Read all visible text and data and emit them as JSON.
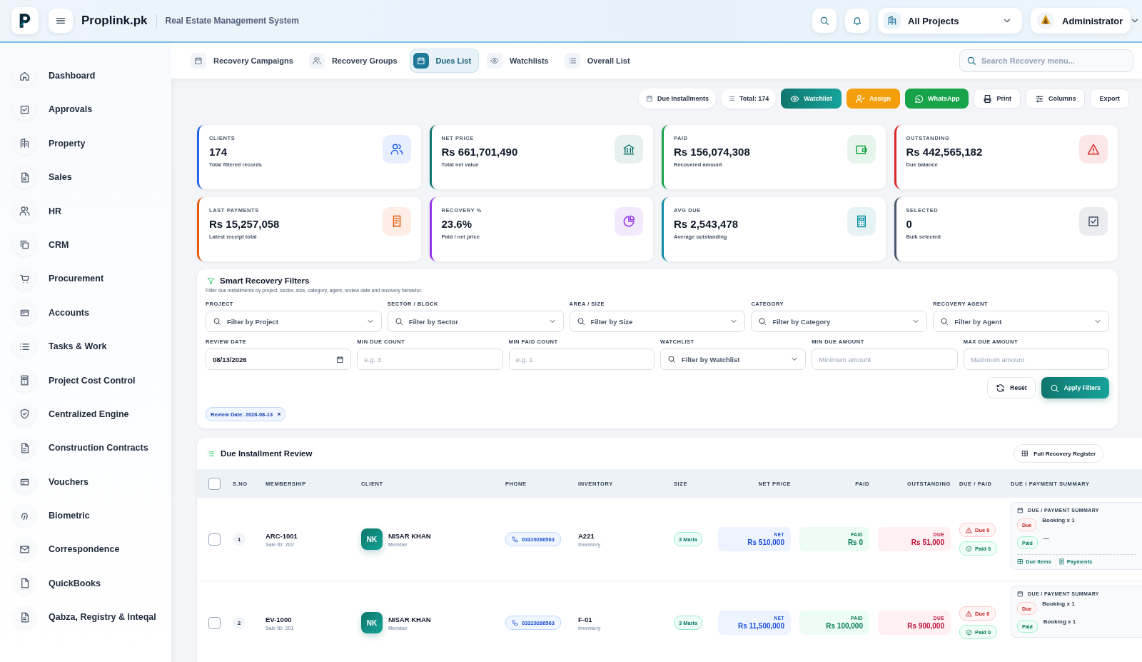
{
  "header": {
    "brand": "Proplink.pk",
    "subtitle": "Real Estate Management System",
    "project_select": "All Projects",
    "user": "Administrator"
  },
  "sidebar": {
    "items": [
      {
        "label": "Dashboard",
        "selected": false
      },
      {
        "label": "Approvals",
        "selected": false
      },
      {
        "label": "Property",
        "selected": false
      },
      {
        "label": "Sales",
        "selected": false
      },
      {
        "label": "HR",
        "selected": false
      },
      {
        "label": "CRM",
        "selected": false
      },
      {
        "label": "Procurement",
        "selected": false
      },
      {
        "label": "Accounts",
        "selected": false
      },
      {
        "label": "Tasks & Work",
        "selected": false
      },
      {
        "label": "Project Cost Control",
        "selected": false
      },
      {
        "label": "Centralized Engine",
        "selected": false
      },
      {
        "label": "Construction Contracts",
        "selected": false
      },
      {
        "label": "Vouchers",
        "selected": false
      },
      {
        "label": "Biometric",
        "selected": false
      },
      {
        "label": "Correspondence",
        "selected": false
      },
      {
        "label": "QuickBooks",
        "selected": false
      },
      {
        "label": "Qabza, Registry & Inteqal",
        "selected": false
      }
    ]
  },
  "tabs": [
    {
      "label": "Recovery Campaigns",
      "selected": false
    },
    {
      "label": "Recovery Groups",
      "selected": false
    },
    {
      "label": "Dues List",
      "selected": true
    },
    {
      "label": "Watchlists",
      "selected": false
    },
    {
      "label": "Overall List",
      "selected": false
    }
  ],
  "search": {
    "placeholder": "Search Recovery menu..."
  },
  "toolbar": [
    {
      "label": "Due Installments",
      "kind": "chip"
    },
    {
      "label": "Total: 174",
      "kind": "chip"
    },
    {
      "label": "Watchlist",
      "kind": "teal"
    },
    {
      "label": "Assign",
      "kind": "orange"
    },
    {
      "label": "WhatsApp",
      "kind": "green"
    },
    {
      "label": "Print",
      "kind": "outline"
    },
    {
      "label": "Columns",
      "kind": "outline"
    },
    {
      "label": "Export",
      "kind": "outline"
    }
  ],
  "stats": [
    {
      "label": "CLIENTS",
      "value": "174",
      "caption": "Total filtered records",
      "color": "#2563eb"
    },
    {
      "label": "NET PRICE",
      "value": "Rs 661,701,490",
      "caption": "Total net value",
      "color": "#0f766e"
    },
    {
      "label": "PAID",
      "value": "Rs 156,074,308",
      "caption": "Recovered amount",
      "color": "#16a34a"
    },
    {
      "label": "OUTSTANDING",
      "value": "Rs 442,565,182",
      "caption": "Due balance",
      "color": "#dc2626"
    },
    {
      "label": "LAST PAYMENTS",
      "value": "Rs 15,257,058",
      "caption": "Latest receipt total",
      "color": "#ea580c"
    },
    {
      "label": "RECOVERY %",
      "value": "23.6%",
      "caption": "Paid / net price",
      "color": "#9333ea"
    },
    {
      "label": "AVG DUE",
      "value": "Rs 2,543,478",
      "caption": "Average outstanding",
      "color": "#0e8fa5"
    },
    {
      "label": "SELECTED",
      "value": "0",
      "caption": "Bulk selected",
      "color": "#475569"
    }
  ],
  "filters": {
    "title": "Smart Recovery Filters",
    "description": "Filter due installments by project, sector, size, category, agent, review date and recovery behavior.",
    "rows": [
      {
        "fields": [
          {
            "label": "PROJECT",
            "kind": "select",
            "placeholder": "Filter by Project"
          },
          {
            "label": "SECTOR / BLOCK",
            "kind": "select",
            "placeholder": "Filter by Sector"
          },
          {
            "label": "AREA / SIZE",
            "kind": "select",
            "placeholder": "Filter by Size"
          },
          {
            "label": "CATEGORY",
            "kind": "select",
            "placeholder": "Filter by Category"
          },
          {
            "label": "RECOVERY AGENT",
            "kind": "select",
            "placeholder": "Filter by Agent"
          }
        ]
      },
      {
        "fields": [
          {
            "label": "REVIEW DATE",
            "kind": "date",
            "value": "08/13/2026"
          },
          {
            "label": "MIN DUE COUNT",
            "kind": "input",
            "placeholder": "e.g. 3"
          },
          {
            "label": "MIN PAID COUNT",
            "kind": "input",
            "placeholder": "e.g. 1"
          },
          {
            "label": "WATCHLIST",
            "kind": "select",
            "placeholder": "Filter by Watchlist"
          },
          {
            "label": "MIN DUE AMOUNT",
            "kind": "input",
            "placeholder": "Minimum amount"
          },
          {
            "label": "MAX DUE AMOUNT",
            "kind": "input",
            "placeholder": "Maximum amount"
          }
        ]
      }
    ],
    "reset": "Reset",
    "apply": "Apply Filters",
    "active": [
      {
        "label": "Review Date: 2026-08-13",
        "remove": "×"
      }
    ]
  },
  "table": {
    "title": "Due Installment Review",
    "register_button": "Full Recovery Register",
    "select_all": {
      "checked": false
    },
    "columns": [
      "S.NO",
      "MEMBERSHIP",
      "CLIENT",
      "PHONE",
      "INVENTORY",
      "SIZE",
      "NET PRICE",
      "PAID",
      "OUTSTANDING",
      "DUE / PAID",
      "DUE / PAYMENT SUMMARY"
    ],
    "rows": [
      {
        "checked": false,
        "sno": "1",
        "membership": "ARC-1001",
        "sale_id": "Sale ID: 202",
        "initials": "NK",
        "client": "NISAR KHAN",
        "role": "Member",
        "phone": "03329286563",
        "inventory": "A221",
        "inventory_sub": "Inventory",
        "size": "3 Marla",
        "net_label": "NET",
        "net": "Rs 510,000",
        "paid_label": "PAID",
        "paid": "Rs 0",
        "due_label": "DUE",
        "due": "Rs 51,000",
        "due_count": "Due 0",
        "paid_count": "Paid 0",
        "summary": {
          "title": "DUE / PAYMENT SUMMARY",
          "due_tag": "Due",
          "due_text": "Booking x 1",
          "paid_tag": "Paid",
          "paid_text": "—",
          "links": [
            "Due Items",
            "Payments"
          ]
        }
      },
      {
        "checked": false,
        "sno": "2",
        "membership": "EV-1000",
        "sale_id": "Sale ID: 201",
        "initials": "NK",
        "client": "NISAR KHAN",
        "role": "Member",
        "phone": "03329286563",
        "inventory": "F-01",
        "inventory_sub": "Inventory",
        "size": "3 Marla",
        "net_label": "NET",
        "net": "Rs 11,500,000",
        "paid_label": "PAID",
        "paid": "Rs 100,000",
        "due_label": "DUE",
        "due": "Rs 900,000",
        "due_count": "Due 0",
        "paid_count": "Paid 0",
        "summary": {
          "title": "DUE / PAYMENT SUMMARY",
          "due_tag": "Due",
          "due_text": "Booking x 1",
          "paid_tag": "Paid",
          "paid_text": "Booking x 1"
        }
      }
    ]
  }
}
